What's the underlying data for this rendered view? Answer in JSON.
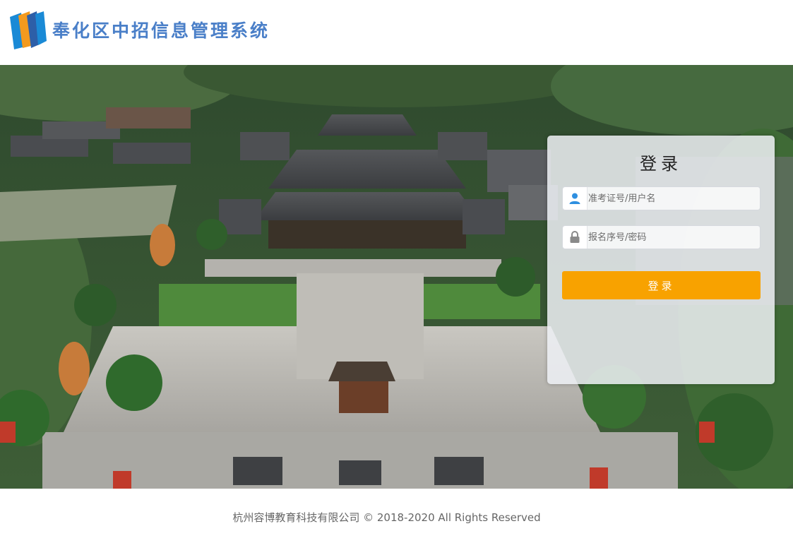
{
  "header": {
    "title": "奉化区中招信息管理系统"
  },
  "login": {
    "title": "登录",
    "username_placeholder": "准考证号/用户名",
    "password_placeholder": "报名序号/密码",
    "submit_label": "登录"
  },
  "footer": {
    "copyright": "杭州容博教育科技有限公司 © 2018-2020 All Rights Reserved"
  },
  "colors": {
    "accent": "#f8a200",
    "title_blue": "#4a7fc8"
  },
  "icons": {
    "username": "user-icon",
    "password": "lock-icon"
  }
}
